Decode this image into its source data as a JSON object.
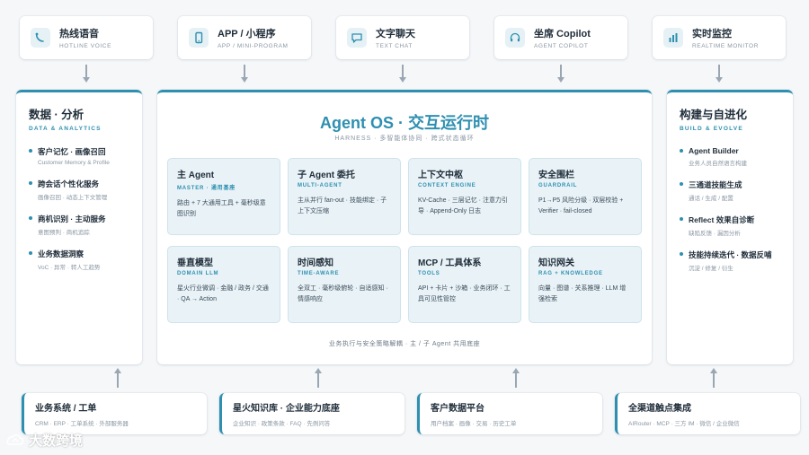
{
  "top_channels": [
    {
      "name": "热线语音",
      "en": "HOTLINE VOICE",
      "icon": "phone-wave-icon"
    },
    {
      "name": "APP / 小程序",
      "en": "APP / MINI-PROGRAM",
      "icon": "mobile-icon"
    },
    {
      "name": "文字聊天",
      "en": "TEXT CHAT",
      "icon": "chat-icon"
    },
    {
      "name": "坐席 Copilot",
      "en": "AGENT COPILOT",
      "icon": "headset-icon"
    },
    {
      "name": "实时监控",
      "en": "REALTIME MONITOR",
      "icon": "bar-chart-icon"
    }
  ],
  "left_panel": {
    "title": "数据 · 分析",
    "subtitle": "DATA & ANALYTICS",
    "items": [
      {
        "title": "客户记忆 · 画像召回",
        "desc": "Customer Memory & Profile"
      },
      {
        "title": "跨会话个性化服务",
        "desc": "画像召回 · 动态上下文管理"
      },
      {
        "title": "商机识别 · 主动服务",
        "desc": "意图预判 · 商机追踪"
      },
      {
        "title": "业务数据洞察",
        "desc": "VoC · 异常 · 转人工趋势"
      }
    ]
  },
  "center": {
    "title": "Agent OS · 交互运行时",
    "subtitle": "HARNESS · 多智能体协同 · 跨式状态循环",
    "modules": [
      {
        "title": "主 Agent",
        "en": "MASTER · 通用基座",
        "desc": "路由 + 7 大通用工具 + 毫秒级意图识别"
      },
      {
        "title": "子 Agent 委托",
        "en": "MULTI-AGENT",
        "desc": "主从并行 fan-out · 技能绑定 · 子上下文压缩"
      },
      {
        "title": "上下文中枢",
        "en": "CONTEXT ENGINE",
        "desc": "KV-Cache · 三层记忆 · 注意力引导 · Append-Only 日志"
      },
      {
        "title": "安全围栏",
        "en": "GUARDRAIL",
        "desc": "P1→P5 风险分级 · 双层校验 + Verifier · fail-closed"
      },
      {
        "title": "垂直模型",
        "en": "DOMAIN LLM",
        "desc": "星火行业微调 · 金融 / 政务 / 交通 · QA → Action"
      },
      {
        "title": "时间感知",
        "en": "TIME-AWARE",
        "desc": "全双工 · 毫秒级俯轮 · 自适感知 · 情感响应"
      },
      {
        "title": "MCP / 工具体系",
        "en": "TOOLS",
        "desc": "API + 卡片 + 沙箱 · 业务闭环 · 工具可见性管控"
      },
      {
        "title": "知识网关",
        "en": "RAG + KNOWLEDGE",
        "desc": "向量 · 图谱 · 关系推理 · LLM 增强检索"
      }
    ],
    "footer": "业务执行与安全策略解耦 · 主 / 子 Agent 共用底座"
  },
  "right_panel": {
    "title": "构建与自进化",
    "subtitle": "BUILD & EVOLVE",
    "items": [
      {
        "title": "Agent Builder",
        "desc": "业务人员自然语言构建"
      },
      {
        "title": "三通道技能生成",
        "desc": "通话 / 生成 / 配置"
      },
      {
        "title": "Reflect 效果自诊断",
        "desc": "缺陷反馈 · 漏因分析"
      },
      {
        "title": "技能持续迭代 · 数据反哺",
        "desc": "沉淀 / 修复 / 衍生"
      }
    ]
  },
  "bottom_systems": [
    {
      "title": "业务系统 / 工单",
      "desc": "CRM · ERP · 工单系统 · 外部服务器"
    },
    {
      "title": "星火知识库 · 企业能力底座",
      "desc": "企业知识 · 政策条款 · FAQ · 先例问答"
    },
    {
      "title": "客户数据平台",
      "desc": "用户档案 · 画像 · 交易 · 历史工单"
    },
    {
      "title": "全渠道触点集成",
      "desc": "AIRouter · MCP · 三方 IM · 微信 / 企业微信"
    }
  ],
  "watermark": "大数跨境",
  "colors": {
    "accent": "#2e8fb0",
    "module_bg": "#e9f3f7"
  }
}
